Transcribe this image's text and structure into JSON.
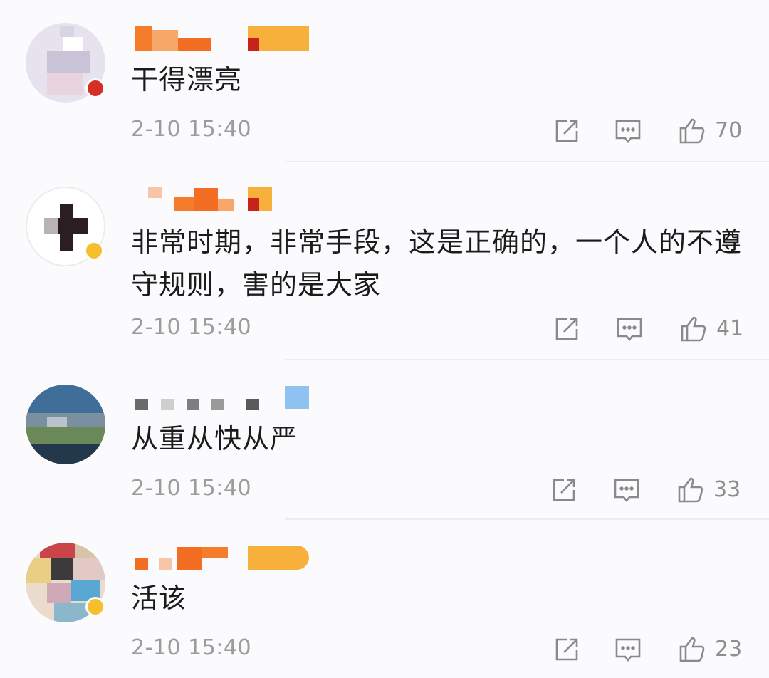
{
  "comments": [
    {
      "text": "干得漂亮",
      "time": "2-10 15:40",
      "likes": "70"
    },
    {
      "text": "非常时期，非常手段，这是正确的，一个人的不遵守规则，害的是大家",
      "time": "2-10 15:40",
      "likes": "41"
    },
    {
      "text": "从重从快从严",
      "time": "2-10 15:40",
      "likes": "33"
    },
    {
      "text": "活该",
      "time": "2-10 15:40",
      "likes": "23"
    }
  ],
  "icons": {
    "share": "share-icon",
    "reply": "comment-icon",
    "like": "thumbs-up-icon"
  },
  "colors": {
    "badge_gold": "#f5c02b",
    "name_orange": "#f57c2a",
    "name_gold": "#f8b03c"
  }
}
